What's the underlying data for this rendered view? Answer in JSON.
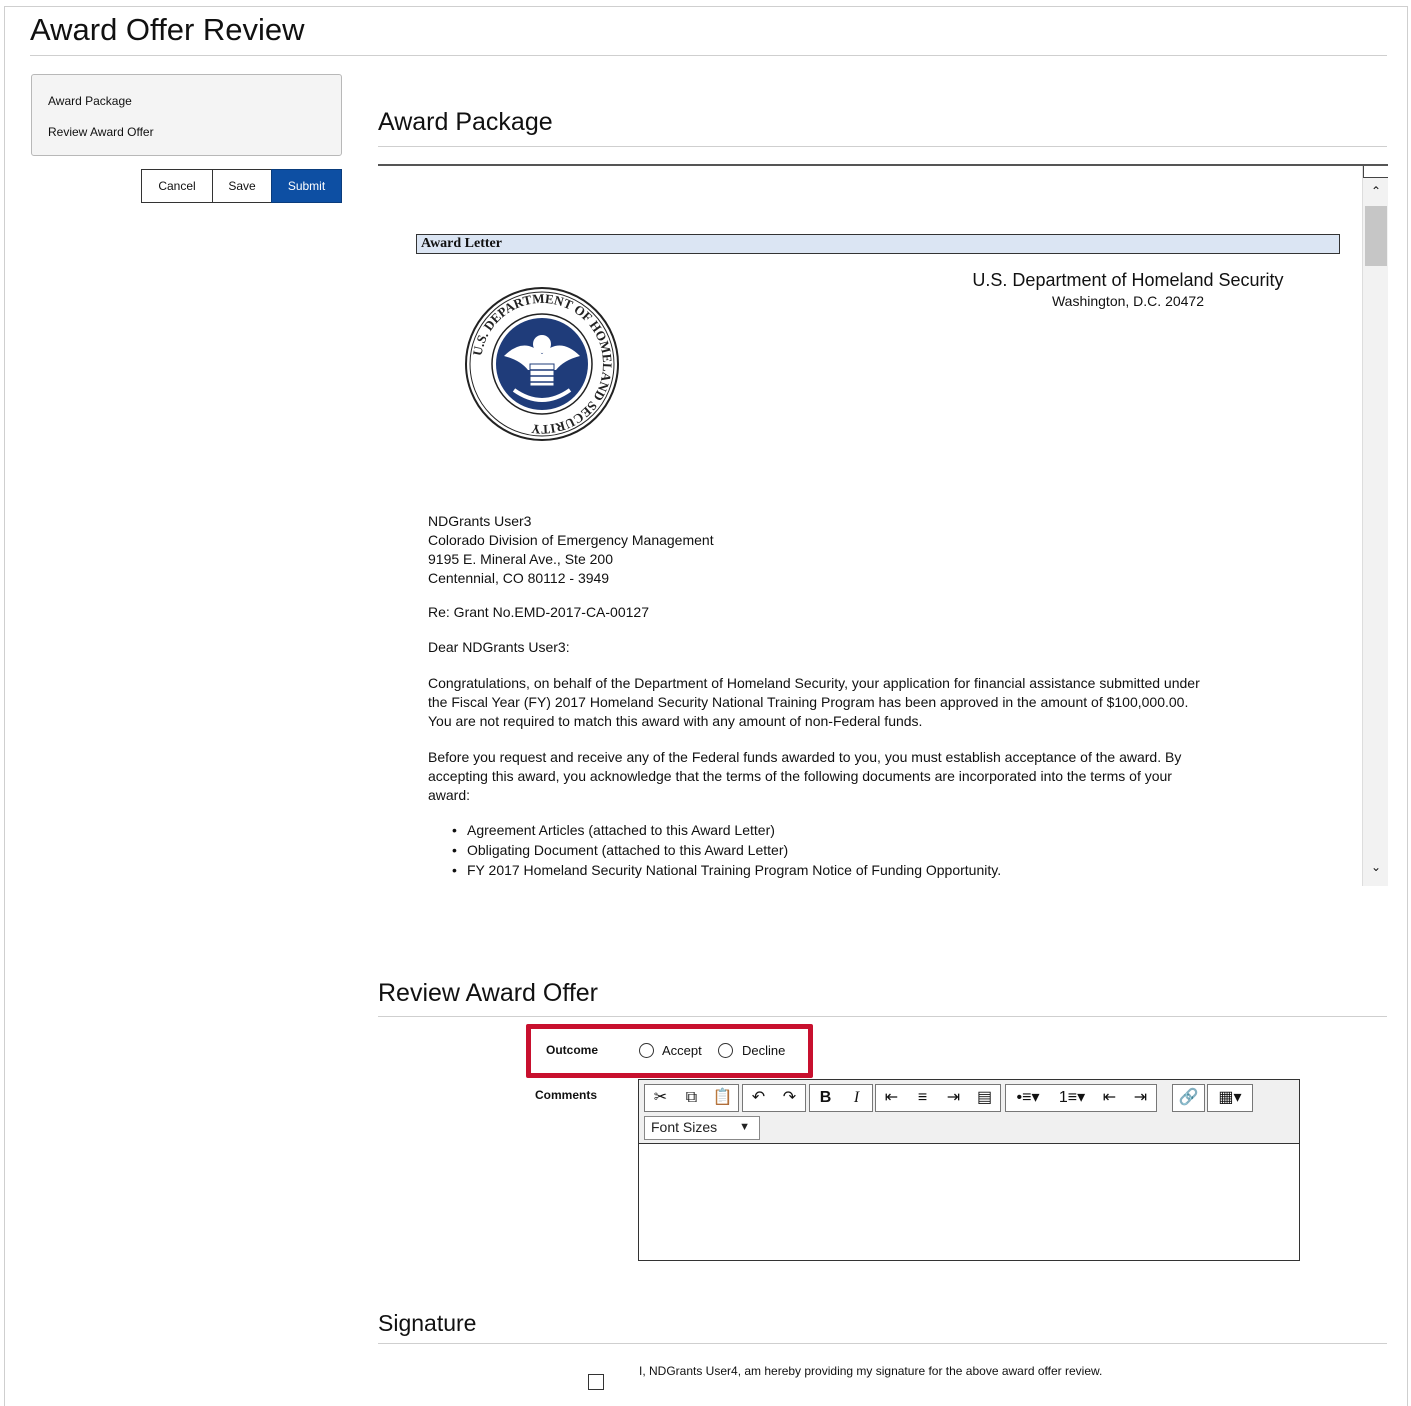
{
  "page": {
    "title": "Award Offer Review"
  },
  "sidebar": {
    "items": [
      {
        "label": "Award Package"
      },
      {
        "label": "Review Award Offer"
      }
    ]
  },
  "actions": {
    "cancel": "Cancel",
    "save": "Save",
    "submit": "Submit"
  },
  "award_package": {
    "heading": "Award Package",
    "letter": {
      "header_bar": "Award Letter",
      "agency_name": "U.S. Department of Homeland Security",
      "agency_address": "Washington, D.C. 20472",
      "seal": {
        "icon": "dhs-seal-icon",
        "text": "U.S. DEPARTMENT OF HOMELAND SECURITY"
      },
      "recipient": [
        "NDGrants User3",
        "Colorado Division of Emergency Management",
        "9195 E. Mineral Ave., Ste 200",
        "Centennial, CO 80112 - 3949"
      ],
      "re_line": "Re: Grant No.EMD-2017-CA-00127",
      "salutation": "Dear NDGrants User3:",
      "para1": [
        "Congratulations, on behalf of the Department of Homeland Security, your application for financial assistance submitted under",
        "the Fiscal Year (FY) 2017 Homeland Security National Training Program has been approved in the amount of $100,000.00.",
        "You are not required to match this award with any amount of non-Federal funds."
      ],
      "para2": [
        "Before you request and receive any of the Federal funds awarded to you, you must establish acceptance of the award. By",
        "accepting this award, you acknowledge that the terms of the following documents are incorporated into the terms of your",
        "award:"
      ],
      "bullets": [
        "Agreement Articles (attached to this Award Letter)",
        "Obligating Document (attached to this Award Letter)",
        "FY 2017 Homeland Security National Training Program Notice of Funding Opportunity."
      ]
    }
  },
  "review": {
    "heading": "Review Award Offer",
    "outcome_label": "Outcome",
    "options": [
      "Accept",
      "Decline"
    ],
    "comments_label": "Comments",
    "toolbar": {
      "icons": [
        "cut-icon",
        "copy-icon",
        "paste-icon",
        "undo-icon",
        "redo-icon",
        "bold-icon",
        "italic-icon",
        "align-left-icon",
        "align-center-icon",
        "align-right-icon",
        "justify-icon",
        "bullet-list-icon",
        "numbered-list-icon",
        "outdent-icon",
        "indent-icon",
        "link-icon",
        "table-icon"
      ],
      "bold": "B",
      "italic": "I",
      "font_sizes": "Font Sizes"
    },
    "highlight_color": "#c8102e"
  },
  "signature": {
    "heading": "Signature",
    "statement": "I, NDGrants User4, am hereby providing my signature for the above award offer review."
  },
  "colors": {
    "primary_button": "#0d4fa3",
    "letter_bar": "#dbe5f3"
  }
}
